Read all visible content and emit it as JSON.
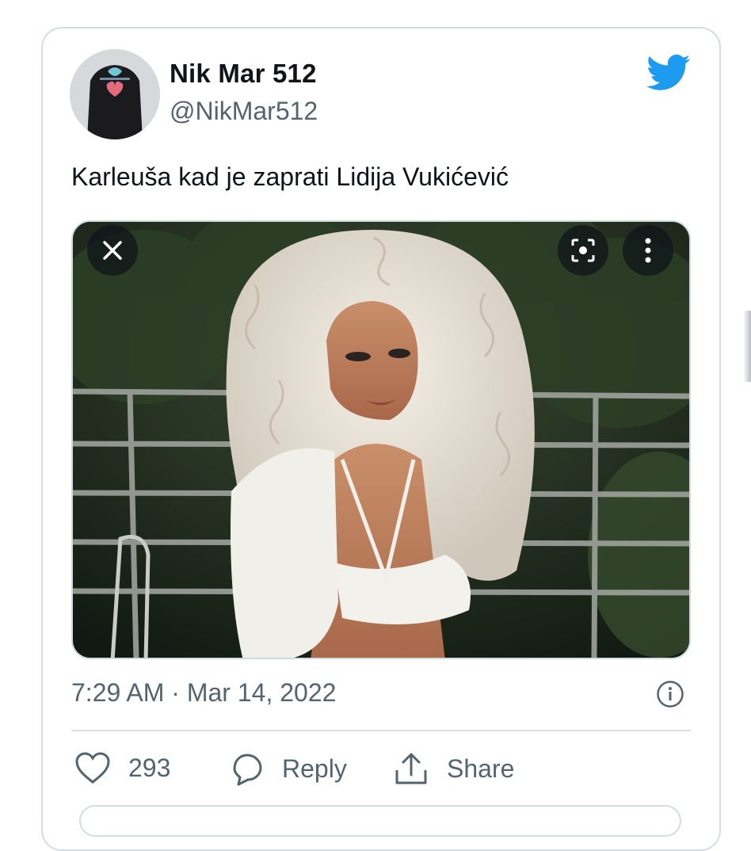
{
  "author": {
    "display_name": "Nik Mar 512",
    "handle": "@NikMar512"
  },
  "tweet": {
    "text": "Karleuša kad je zaprati Lidija Vukićević",
    "timestamp": "7:29 AM · Mar 14, 2022"
  },
  "media": {
    "close_icon": "close-icon",
    "scan_icon": "lens-scan-icon",
    "more_icon": "more-vertical-icon"
  },
  "actions": {
    "like_count": "293",
    "reply_label": "Reply",
    "share_label": "Share"
  },
  "colors": {
    "brand": "#1d9bf0",
    "text": "#0f1419",
    "secondary": "#536471",
    "border": "#d3dde6"
  }
}
